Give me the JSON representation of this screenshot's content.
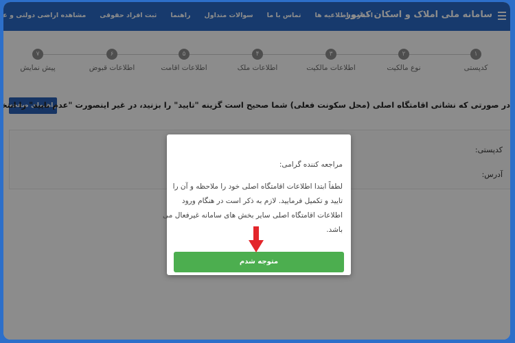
{
  "header": {
    "title": "سامانه ملی املاک و اسکان کشور",
    "menu_icon": "hamburger-menu-icon",
    "links": [
      {
        "label": "اخبار و اطلاعیه ها"
      },
      {
        "label": "تماس با ما"
      },
      {
        "label": "سوالات متداول"
      },
      {
        "label": "راهنما"
      },
      {
        "label": "ثبت افراد حقوقی"
      },
      {
        "label": "مشاهده اراضی دولتی و عمومی"
      }
    ]
  },
  "stepper": {
    "steps": [
      {
        "number": "۱",
        "label": "کدپستی"
      },
      {
        "number": "۲",
        "label": "نوع مالکیت"
      },
      {
        "number": "۳",
        "label": "اطلاعات مالکیت"
      },
      {
        "number": "۴",
        "label": "اطلاعات ملک"
      },
      {
        "number": "۵",
        "label": "اطلاعات اقامت"
      },
      {
        "number": "۶",
        "label": "اطلاعات قبوض"
      },
      {
        "number": "۷",
        "label": "پیش نمایش"
      }
    ]
  },
  "main": {
    "instruction": "در صورتی که نشانی اقامتگاه اصلی (محل سکونت فعلی) شما صحیح است گزینه \"تایید\" را بزنید، در غیر اینصورت \"عدم تایید\" را انتخاب کنید",
    "guide_button": "راهنمای صفحه",
    "postal_code_label": "کدپستی:",
    "address_label": "آدرس:"
  },
  "modal": {
    "greeting": "مراجعه کننده گرامی:",
    "body_lines": [
      "لطفاً ابتدا اطلاعات اقامتگاه اصلی خود را ملاحظه و آن را",
      "تایید و تکمیل فرمایید. لازم به ذکر است در هنگام ورود",
      "اطلاعات اقامتگاه اصلی سایر بخش های سامانه غیرفعال می",
      "باشد."
    ],
    "confirm_label": "متوجه شدم"
  },
  "colors": {
    "header": "#2b6bc6",
    "confirm": "#4cae4f",
    "arrow": "#e3262b",
    "step_circle": "#8e8e8e"
  }
}
